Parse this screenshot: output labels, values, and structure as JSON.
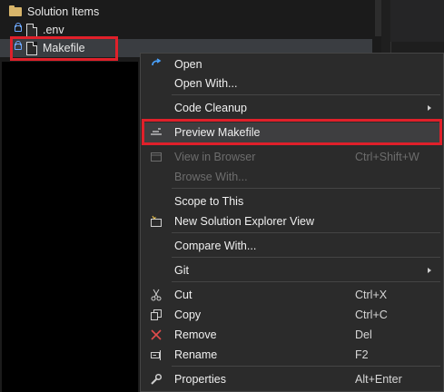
{
  "explorer": {
    "solution_items_label": "Solution Items",
    "env_label": ".env",
    "makefile_label": "Makefile"
  },
  "menu": {
    "items": [
      {
        "label": "Open",
        "shortcut": "",
        "icon": "open-icon"
      },
      {
        "label": "Open With...",
        "shortcut": ""
      },
      {
        "label": "Code Cleanup",
        "shortcut": "",
        "submenu": true
      },
      {
        "label": "Preview Makefile",
        "shortcut": "",
        "icon": "preview-icon"
      },
      {
        "label": "View in Browser",
        "shortcut": "Ctrl+Shift+W",
        "disabled": true,
        "icon": "browser-icon"
      },
      {
        "label": "Browse With...",
        "shortcut": "",
        "disabled": true
      },
      {
        "label": "Scope to This",
        "shortcut": ""
      },
      {
        "label": "New Solution Explorer View",
        "shortcut": "",
        "icon": "new-explorer-view-icon"
      },
      {
        "label": "Compare With...",
        "shortcut": ""
      },
      {
        "label": "Git",
        "shortcut": "",
        "submenu": true
      },
      {
        "label": "Cut",
        "shortcut": "Ctrl+X",
        "icon": "scissors-icon"
      },
      {
        "label": "Copy",
        "shortcut": "Ctrl+C",
        "icon": "copy-icon"
      },
      {
        "label": "Remove",
        "shortcut": "Del",
        "icon": "remove-x-icon"
      },
      {
        "label": "Rename",
        "shortcut": "F2",
        "icon": "rename-icon"
      },
      {
        "label": "Properties",
        "shortcut": "Alt+Enter",
        "icon": "wrench-icon"
      }
    ]
  },
  "colors": {
    "highlight_border": "#e0202a",
    "menu_background": "#2b2b2b",
    "accent_blue": "#6ea8ff"
  }
}
